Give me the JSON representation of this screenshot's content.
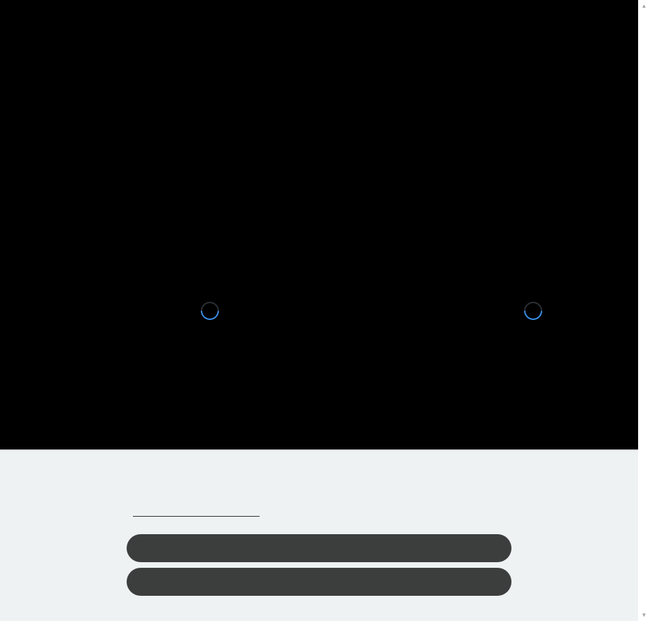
{
  "video": {
    "background_color": "#000000",
    "spinner_color": "#3a8ee6",
    "left_spinner_icon": "loading-spinner-icon",
    "right_spinner_icon": "loading-spinner-icon"
  },
  "form": {
    "input_value": "",
    "input_placeholder": "",
    "primary_button_label": "",
    "secondary_button_label": "",
    "button_color": "#3c3d3d",
    "panel_background": "#eef2f3"
  },
  "scrollbar": {
    "up_icon": "▲",
    "down_icon": "▼"
  }
}
